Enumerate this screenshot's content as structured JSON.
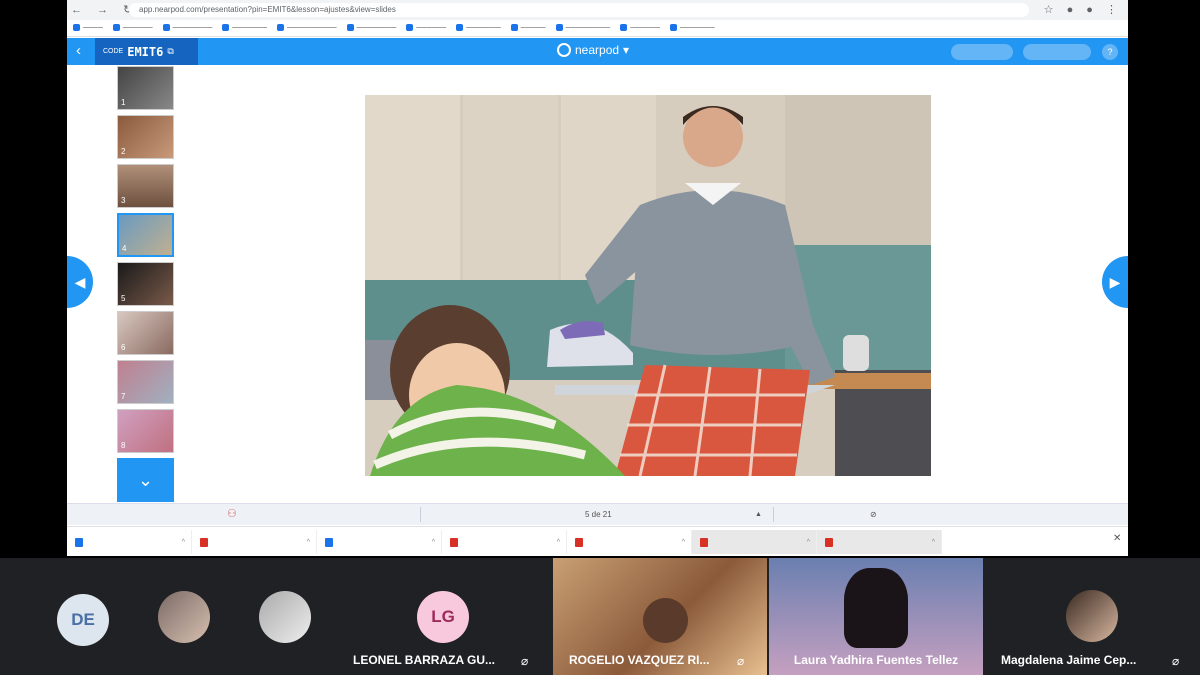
{
  "browser": {
    "url": "app.nearpod.com/presentation?pin=EMIT6&lesson=ajustes&view=slides"
  },
  "nearpod": {
    "code_label": "CODE",
    "code": "EMIT6",
    "logo": "nearpod",
    "slide_counter": "5 de 21"
  },
  "thumbnails": [
    {
      "num": "1"
    },
    {
      "num": "2"
    },
    {
      "num": "3"
    },
    {
      "num": "4"
    },
    {
      "num": "5"
    },
    {
      "num": "6"
    },
    {
      "num": "7"
    },
    {
      "num": "8"
    }
  ],
  "meet": {
    "participants": [
      {
        "initials": "DE"
      },
      {
        "initials": "LG",
        "name": "LEONEL BARRAZA GU..."
      },
      {
        "name": "ROGELIO VAZQUEZ RI..."
      },
      {
        "name": "Laura Yadhira Fuentes Tellez"
      },
      {
        "name": "Magdalena Jaime Cep..."
      }
    ]
  },
  "colors": {
    "accent": "#2196f3",
    "accent_dark": "#1565c0",
    "meet_bg": "#202124",
    "avatar_lg": "#f8c8dc"
  }
}
